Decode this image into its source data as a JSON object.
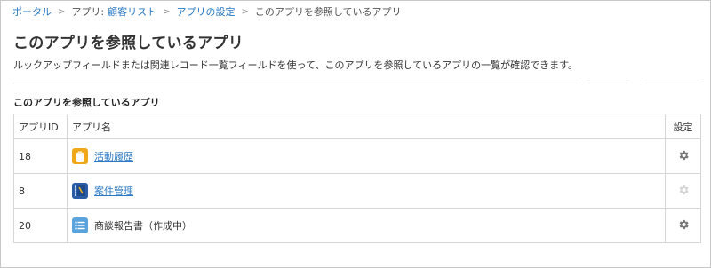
{
  "breadcrumb": {
    "items": [
      {
        "label": "ポータル",
        "link": true
      },
      {
        "label": "アプリ:",
        "link": false
      },
      {
        "label": "顧客リスト",
        "link": true
      },
      {
        "label": "アプリの設定",
        "link": true
      },
      {
        "label": "このアプリを参照しているアプリ",
        "link": false
      }
    ],
    "separator": ">"
  },
  "page": {
    "title": "このアプリを参照しているアプリ",
    "description": "ルックアップフィールドまたは関連レコード一覧フィールドを使って、このアプリを参照しているアプリの一覧が確認できます。"
  },
  "section": {
    "heading": "このアプリを参照しているアプリ"
  },
  "table": {
    "headers": {
      "id": "アプリID",
      "name": "アプリ名",
      "settings": "設定"
    },
    "rows": [
      {
        "id": "18",
        "name": "活動履歴",
        "link": true,
        "icon": "clipboard-icon",
        "icon_color": "#f0a818",
        "settings_enabled": true
      },
      {
        "id": "8",
        "name": "案件管理",
        "link": true,
        "icon": "notebook-icon",
        "icon_color": "#2a5ca8",
        "settings_enabled": false
      },
      {
        "id": "20",
        "name": "商談報告書（作成中）",
        "link": false,
        "icon": "list-icon",
        "icon_color": "#5aa3dc",
        "settings_enabled": true
      }
    ]
  },
  "colors": {
    "link": "#2a78c3",
    "gear_enabled": "#777777",
    "gear_disabled": "#d5d5d5",
    "border": "#d6d6d6"
  }
}
